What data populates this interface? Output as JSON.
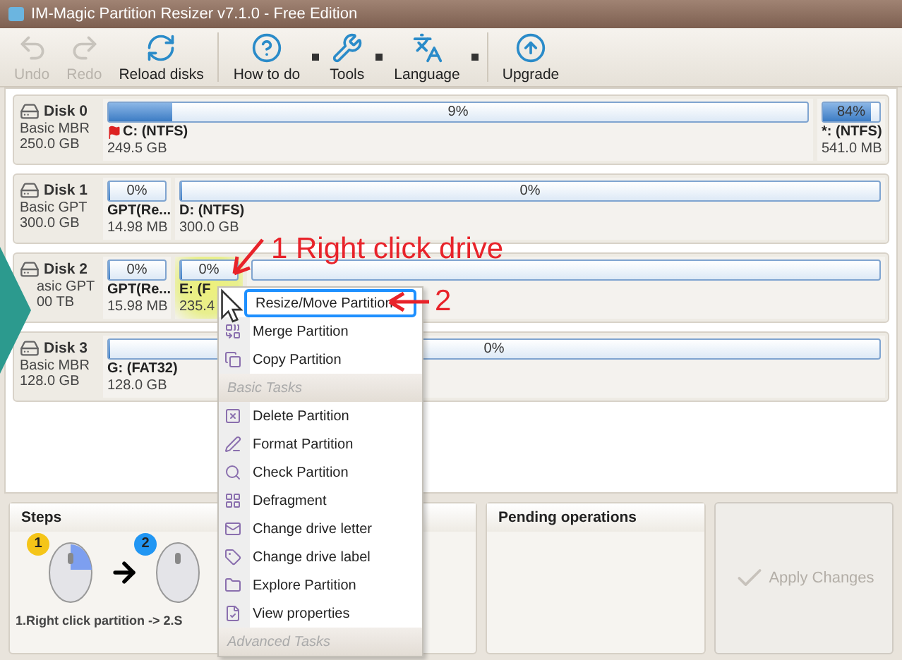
{
  "window": {
    "title": "IM-Magic Partition Resizer v7.1.0 - Free Edition"
  },
  "toolbar": [
    {
      "label": "Undo",
      "disabled": true,
      "dropdown": false
    },
    {
      "label": "Redo",
      "disabled": true,
      "dropdown": false
    },
    {
      "label": "Reload disks",
      "disabled": false,
      "dropdown": false
    },
    {
      "label": "How to do",
      "disabled": false,
      "dropdown": true
    },
    {
      "label": "Tools",
      "disabled": false,
      "dropdown": true
    },
    {
      "label": "Language",
      "disabled": false,
      "dropdown": true
    },
    {
      "label": "Upgrade",
      "disabled": false,
      "dropdown": false
    }
  ],
  "disks": [
    {
      "name": "Disk 0",
      "type": "Basic MBR",
      "size": "250.0 GB",
      "partitions": [
        {
          "kind": "main",
          "name": "C: (NTFS)",
          "size": "249.5 GB",
          "usage": "9%",
          "level": 0.09,
          "boot": true,
          "highlighted": false
        },
        {
          "kind": "small",
          "name": "*: (NTFS)",
          "size": "541.0 MB",
          "usage": "84%",
          "level": 0.84,
          "boot": false,
          "highlighted": false
        }
      ]
    },
    {
      "name": "Disk 1",
      "type": "Basic GPT",
      "size": "300.0 GB",
      "partitions": [
        {
          "kind": "small",
          "name": "GPT(Re...",
          "size": "14.98 MB",
          "usage": "0%",
          "level": 0,
          "boot": false,
          "highlighted": false
        },
        {
          "kind": "main",
          "name": "D: (NTFS)",
          "size": "300.0 GB",
          "usage": "0%",
          "level": 0,
          "boot": false,
          "highlighted": false
        }
      ]
    },
    {
      "name": "Disk 2",
      "type": "asic GPT",
      "size": "00 TB",
      "partitions": [
        {
          "kind": "small",
          "name": "GPT(Re...",
          "size": "15.98 MB",
          "usage": "0%",
          "level": 0,
          "boot": false,
          "highlighted": false
        },
        {
          "kind": "small",
          "name": "E: (F",
          "size": "235.4",
          "usage": "0%",
          "level": 0,
          "boot": false,
          "highlighted": true
        },
        {
          "kind": "main"
        }
      ]
    },
    {
      "name": "Disk 3",
      "type": "Basic MBR",
      "size": "128.0 GB",
      "partitions": [
        {
          "kind": "main",
          "name": "G: (FAT32)",
          "size": "128.0 GB",
          "usage": "0%",
          "level": 0,
          "boot": false,
          "highlighted": false
        }
      ]
    }
  ],
  "steps": {
    "title": "Steps",
    "badges": [
      "1",
      "2"
    ],
    "caption": "1.Right click partition -> 2.S"
  },
  "pending": {
    "title": "Pending operations"
  },
  "apply_button": {
    "label": "Apply Changes",
    "disabled": true
  },
  "context_menu": [
    {
      "kind": "item",
      "label": "Resize/Move Partition",
      "selected": true
    },
    {
      "kind": "item",
      "label": "Merge Partition",
      "selected": false
    },
    {
      "kind": "item",
      "label": "Copy Partition",
      "selected": false
    },
    {
      "kind": "header",
      "label": "Basic Tasks"
    },
    {
      "kind": "item",
      "label": "Delete Partition",
      "selected": false
    },
    {
      "kind": "item",
      "label": "Format Partition",
      "selected": false
    },
    {
      "kind": "item",
      "label": "Check Partition",
      "selected": false
    },
    {
      "kind": "item",
      "label": "Defragment",
      "selected": false
    },
    {
      "kind": "item",
      "label": "Change drive letter",
      "selected": false
    },
    {
      "kind": "item",
      "label": "Change drive label",
      "selected": false
    },
    {
      "kind": "item",
      "label": "Explore Partition",
      "selected": false
    },
    {
      "kind": "item",
      "label": "View properties",
      "selected": false
    },
    {
      "kind": "header",
      "label": "Advanced Tasks"
    }
  ],
  "annotations": [
    {
      "label": "1 Right click drive"
    },
    {
      "label": "2"
    }
  ]
}
